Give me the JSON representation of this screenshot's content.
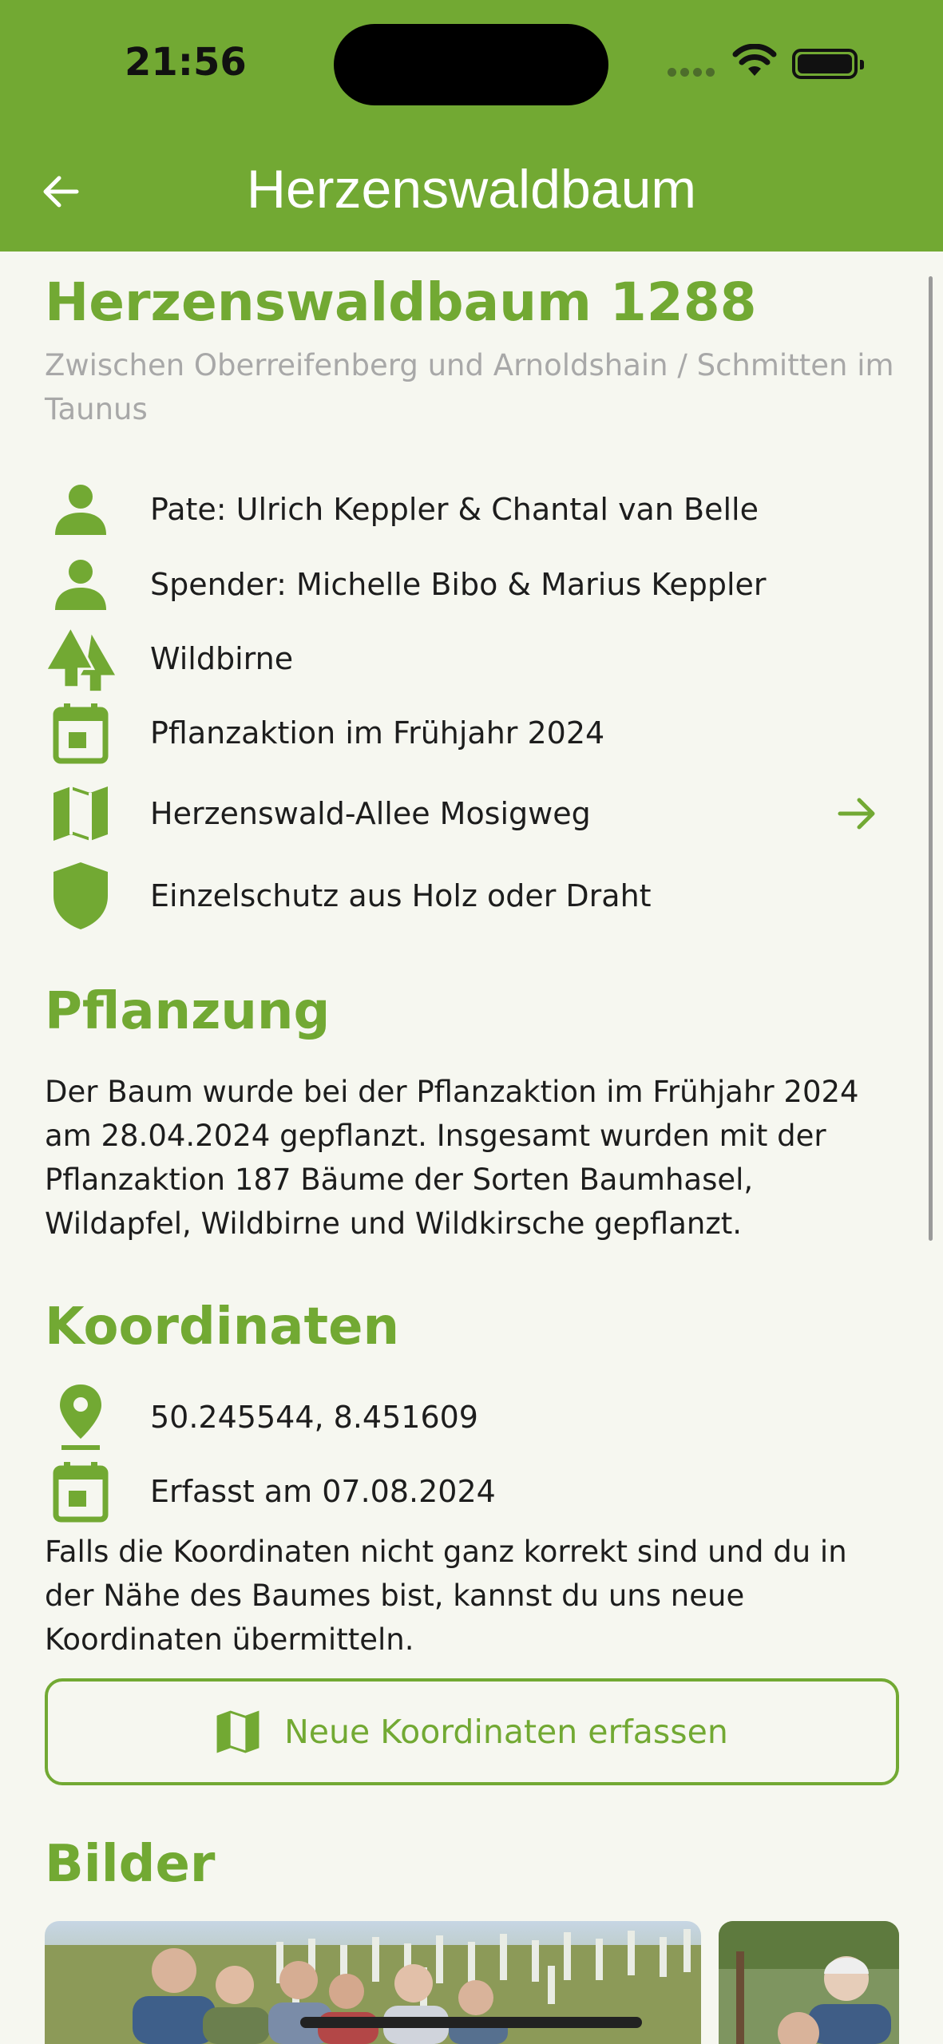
{
  "status_bar": {
    "time": "21:56"
  },
  "header": {
    "title": "Herzenswaldbaum"
  },
  "tree": {
    "title": "Herzenswaldbaum 1288",
    "location": "Zwischen Oberreifenberg und Arnoldshain / Schmitten im Taunus"
  },
  "info": {
    "pate": "Pate: Ulrich Keppler & Chantal van Belle",
    "spender": "Spender: Michelle Bibo & Marius Keppler",
    "species": "Wildbirne",
    "campaign": "Pflanzaktion im Frühjahr 2024",
    "allee": "Herzenswald-Allee Mosigweg",
    "protection": "Einzelschutz aus Holz oder Draht"
  },
  "pflanzung": {
    "heading": "Pflanzung",
    "text": "Der Baum wurde bei der Pflanzaktion im Frühjahr 2024 am 28.04.2024 gepflanzt. Insgesamt wurden mit der Pflanzaktion 187 Bäume der Sorten Baumhasel, Wildapfel, Wildbirne und Wildkirsche gepflanzt."
  },
  "koordinaten": {
    "heading": "Koordinaten",
    "coords": "50.245544, 8.451609",
    "recorded": "Erfasst am 07.08.2024",
    "hint": "Falls die Koordinaten nicht ganz korrekt sind und du in der Nähe des Baumes bist, kannst du uns neue Koordinaten übermitteln.",
    "button_label": "Neue Koordinaten erfassen"
  },
  "bilder": {
    "heading": "Bilder"
  },
  "icons": {
    "back": "arrow-left-icon",
    "pate": "person-icon",
    "spender": "person-icon",
    "species": "trees-icon",
    "campaign": "calendar-icon",
    "allee": "map-icon",
    "protection": "shield-icon",
    "coords": "map-pin-icon",
    "recorded": "calendar-icon",
    "open": "arrow-right-icon"
  },
  "colors": {
    "brand_green": "#72a933",
    "background": "#f6f7f0",
    "subtitle_gray": "#a8a8a8"
  }
}
